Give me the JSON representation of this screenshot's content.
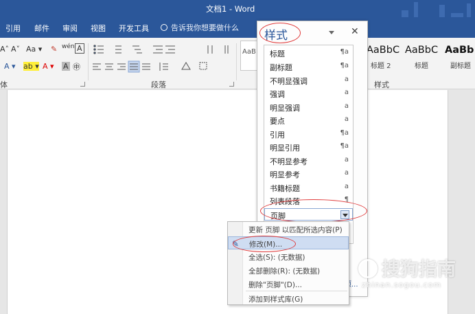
{
  "window": {
    "title": "文档1 - Word"
  },
  "tabs": [
    "引用",
    "邮件",
    "审阅",
    "视图",
    "开发工具"
  ],
  "tell_me": {
    "placeholder": "告诉我你想要做什么"
  },
  "ribbon": {
    "font_row1": [
      "A˄",
      "A˅",
      "Aa ▾",
      "✎",
      "wén",
      "A"
    ],
    "font_row2": [
      "A ▾",
      "ab ▾",
      "A ▾",
      "A",
      "㊥"
    ],
    "paragraph_label": "段落",
    "styles_label": "样式",
    "font_group_fragment": "体",
    "style_box_text": "AaB",
    "gallery": [
      {
        "preview": "AaBbC",
        "label": "标题 2"
      },
      {
        "preview": "AaBbC",
        "label": "标题"
      },
      {
        "preview": "AaBb",
        "label": "副标题"
      }
    ]
  },
  "styles_pane": {
    "title": "样式",
    "items": [
      {
        "label": "标题",
        "symbol": "¶a"
      },
      {
        "label": "副标题",
        "symbol": "¶a"
      },
      {
        "label": "不明显强调",
        "symbol": "a"
      },
      {
        "label": "强调",
        "symbol": "a"
      },
      {
        "label": "明显强调",
        "symbol": "a"
      },
      {
        "label": "要点",
        "symbol": "a"
      },
      {
        "label": "引用",
        "symbol": "¶a"
      },
      {
        "label": "明显引用",
        "symbol": "¶a"
      },
      {
        "label": "不明显参考",
        "symbol": "a"
      },
      {
        "label": "明显参考",
        "symbol": "a"
      },
      {
        "label": "书籍标题",
        "symbol": "a"
      },
      {
        "label": "列表段落",
        "symbol": "¶"
      }
    ],
    "selected_item": "页脚",
    "footer_link": "项..."
  },
  "context_menu": {
    "items": [
      "更新 页脚 以匹配所选内容(P)",
      "修改(M)...",
      "全选(S): (无数据)",
      "全部删除(R): (无数据)",
      "删除\"页脚\"(D)...",
      "添加到样式库(G)"
    ]
  },
  "watermark": {
    "brand": "搜狗指南",
    "url": "zhinan.sogou.com"
  },
  "colors": {
    "accent": "#2b579a",
    "annotation": "#e03a3a"
  }
}
